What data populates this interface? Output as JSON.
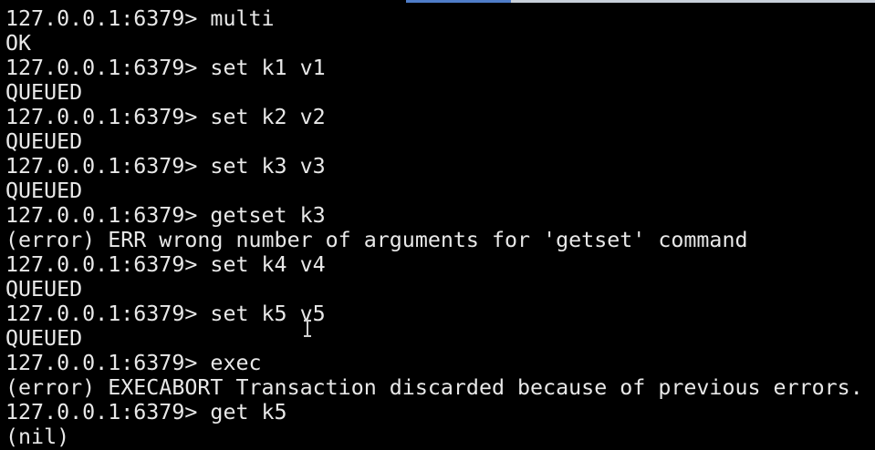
{
  "terminal": {
    "lines": [
      "127.0.0.1:6379> multi",
      "OK",
      "127.0.0.1:6379> set k1 v1",
      "QUEUED",
      "127.0.0.1:6379> set k2 v2",
      "QUEUED",
      "127.0.0.1:6379> set k3 v3",
      "QUEUED",
      "127.0.0.1:6379> getset k3",
      "(error) ERR wrong number of arguments for 'getset' command",
      "127.0.0.1:6379> set k4 v4",
      "QUEUED",
      "127.0.0.1:6379> set k5 v5",
      "QUEUED",
      "127.0.0.1:6379> exec",
      "(error) EXECABORT Transaction discarded because of previous errors.",
      "127.0.0.1:6379> get k5",
      "(nil)"
    ],
    "colors": {
      "background": "#000000",
      "text": "#e8e8e8"
    },
    "cursor_icon": "text-cursor-icon"
  }
}
